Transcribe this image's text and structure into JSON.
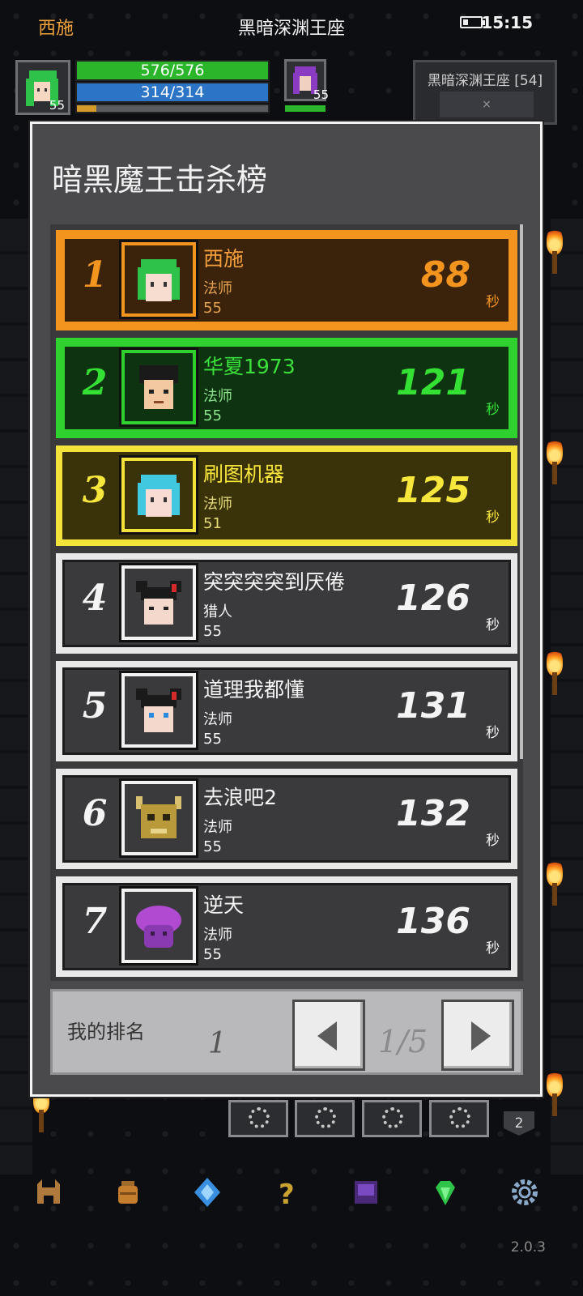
{
  "status_bar": {
    "player_name": "西施",
    "location": "黑暗深渊王座",
    "time": "15:15"
  },
  "hud": {
    "player_level": "55",
    "hp": "576/576",
    "mp": "314/314",
    "xp_fraction": 0.1,
    "enemy_level": "55",
    "zone_label": "黑暗深渊王座 [54]",
    "zone_inner": "×"
  },
  "panel": {
    "title": "暗黑魔王击杀榜",
    "time_unit": "秒",
    "rows": [
      {
        "rank": "1",
        "name": "西施",
        "class": "法师",
        "level": "55",
        "time": "88",
        "avatar": "green-hair-girl-avatar"
      },
      {
        "rank": "2",
        "name": "华夏1973",
        "class": "法师",
        "level": "55",
        "time": "121",
        "avatar": "black-hair-boy-avatar"
      },
      {
        "rank": "3",
        "name": "刷图机器",
        "class": "法师",
        "level": "51",
        "time": "125",
        "avatar": "cyan-hair-girl-avatar"
      },
      {
        "rank": "4",
        "name": "突突突突到厌倦",
        "class": "猎人",
        "level": "55",
        "time": "126",
        "avatar": "black-buns-girl-avatar"
      },
      {
        "rank": "5",
        "name": "道理我都懂",
        "class": "法师",
        "level": "55",
        "time": "131",
        "avatar": "black-buns-blue-eyes-avatar"
      },
      {
        "rank": "6",
        "name": "去浪吧2",
        "class": "法师",
        "level": "55",
        "time": "132",
        "avatar": "golden-horned-skull-avatar"
      },
      {
        "rank": "7",
        "name": "逆天",
        "class": "法师",
        "level": "55",
        "time": "136",
        "avatar": "purple-mushroom-avatar"
      }
    ],
    "footer": {
      "my_rank_label": "我的排名",
      "my_rank": "1",
      "page": "1/5"
    }
  },
  "skill_badge": "2",
  "toolbar": [
    {
      "icon": "helmet-icon"
    },
    {
      "icon": "bag-icon"
    },
    {
      "icon": "crystal-icon"
    },
    {
      "icon": "question-icon"
    },
    {
      "icon": "spellbook-icon"
    },
    {
      "icon": "gem-icon"
    },
    {
      "icon": "settings-gear-icon"
    }
  ],
  "version": "2.0.3",
  "colors": {
    "rank1": "#f3941e",
    "rank2": "#2ed12e",
    "rank3": "#f2e23a",
    "hp": "#2bb52b",
    "mp": "#2c74c6"
  }
}
